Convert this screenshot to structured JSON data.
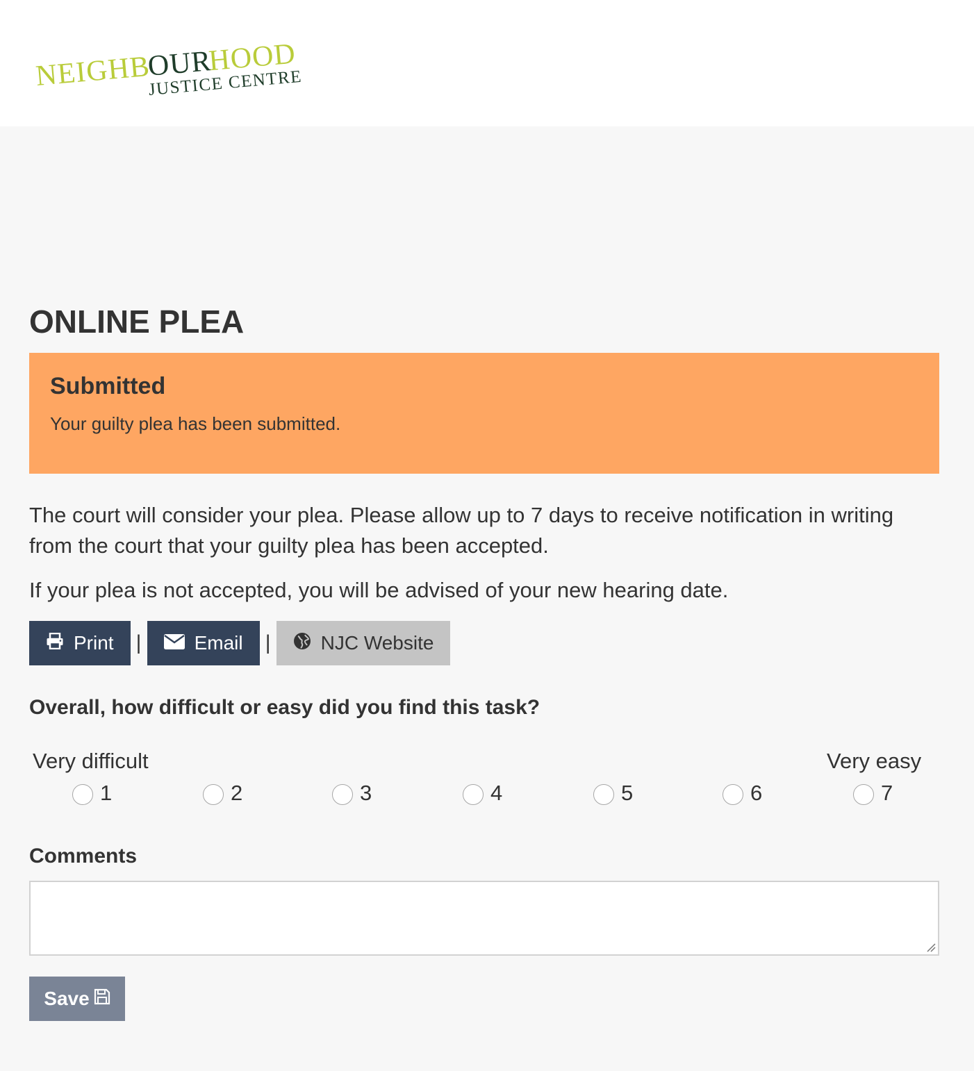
{
  "header": {
    "logo": {
      "line1_part1": "NEIGHB",
      "line1_part2": "OUR",
      "line1_part3": "HOOD",
      "line2": "JUSTICE CENTRE"
    },
    "colors": {
      "lime": "#b9cc3a",
      "dark_green": "#1f3d2a"
    }
  },
  "page": {
    "title": "ONLINE PLEA"
  },
  "alert": {
    "title": "Submitted",
    "message": "Your guilty plea has been submitted.",
    "color": "#fea662"
  },
  "body": {
    "paragraph1": "The court will consider your plea. Please allow up to 7 days to receive notification in writing from the court that your guilty plea has been accepted.",
    "paragraph2": "If your plea is not accepted, you will be advised of your new hearing date."
  },
  "actions": {
    "print": {
      "label": "Print",
      "icon": "printer-icon"
    },
    "separator": "|",
    "email": {
      "label": "Email",
      "icon": "envelope-icon"
    },
    "website": {
      "label": "NJC Website",
      "icon": "globe-icon"
    }
  },
  "survey": {
    "question": "Overall, how difficult or easy did you find this task?",
    "scale_min_label": "Very difficult",
    "scale_max_label": "Very easy",
    "options": [
      "1",
      "2",
      "3",
      "4",
      "5",
      "6",
      "7"
    ],
    "selected": null
  },
  "comments": {
    "label": "Comments",
    "value": ""
  },
  "save": {
    "label": "Save",
    "icon": "floppy-disk-icon"
  }
}
